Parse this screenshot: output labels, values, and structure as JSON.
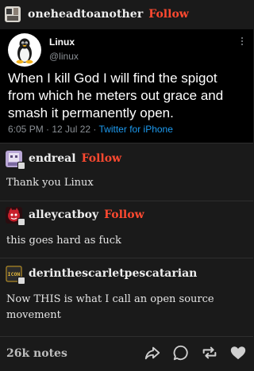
{
  "post": {
    "author": "oneheadtoanother",
    "follow_label": "Follow"
  },
  "tweet": {
    "name": "Linux",
    "handle": "@linux",
    "text": "When I kill God I will find the spigot from which he meters out grace and smash it permanently open.",
    "time": "6:05 PM · 12 Jul 22 · ",
    "client": "Twitter for iPhone"
  },
  "replies": [
    {
      "user": "endreal",
      "follow": "Follow",
      "text": "Thank you Linux"
    },
    {
      "user": "alleycatboy",
      "follow": "Follow",
      "text": "this goes hard as fuck"
    },
    {
      "user": "derinthescarletpescatarian",
      "text": "Now THIS is what I call an open source movement",
      "avatar_label": "ICON"
    }
  ],
  "footer": {
    "notes": "26k notes",
    "icons": [
      "share-icon",
      "reply-icon",
      "reblog-icon",
      "like-icon"
    ]
  },
  "colors": {
    "background": "#1a1a1a",
    "tweet_background": "#000000",
    "follow": "#ff4930",
    "twitter_link": "#1d9bf0"
  }
}
